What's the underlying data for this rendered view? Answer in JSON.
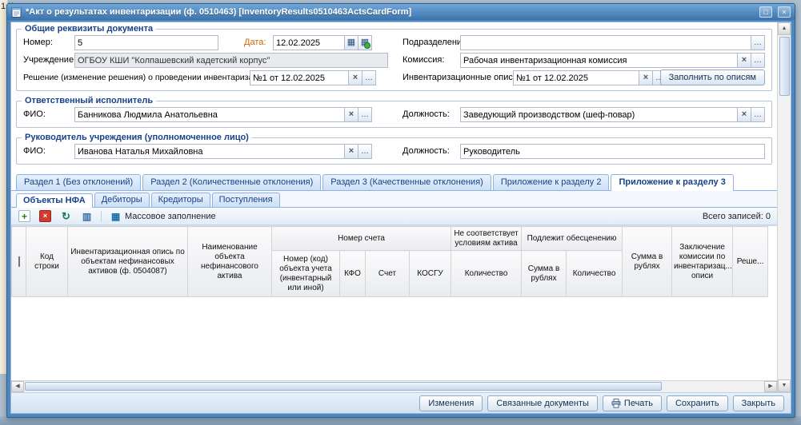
{
  "colors": {
    "accent": "#15428b",
    "titlebar_top": "#71a7d8",
    "titlebar_bottom": "#3c73aa",
    "date_label": "#cc6608",
    "delete_icon": "#d23b2f",
    "add_icon": "#1e7d1e"
  },
  "icons": {
    "add": "+",
    "delete": "×",
    "refresh": "↻",
    "copy": "▥",
    "mass_fill": "▦",
    "lookup": "…",
    "clear": "×",
    "calendar": "▦",
    "calendar_today": "▦",
    "maximize": "□",
    "close": "×",
    "arrow_up": "▲",
    "arrow_down": "▼",
    "arrow_left": "◀",
    "arrow_right": "▶"
  },
  "background": {
    "partial_text": "1 К"
  },
  "window": {
    "title": "*Акт о результатах инвентаризации (ф. 0510463) [InventoryResults0510463ActsCardForm]"
  },
  "general": {
    "legend": "Общие реквизиты документа",
    "number_label": "Номер:",
    "number_value": "5",
    "date_label": "Дата:",
    "date_value": "12.02.2025",
    "department_label": "Подразделение:",
    "department_value": "",
    "institution_label": "Учреждение:",
    "institution_value": "ОГБОУ КШИ \"Колпашевский кадетский корпус\"",
    "commission_label": "Комиссия:",
    "commission_value": "Рабочая инвентаризационная комиссия",
    "decision_label": "Решение (изменение решения) о проведении инвентаризации:",
    "decision_value": "№1 от 12.02.2025",
    "inventories_label": "Инвентаризационные описи:",
    "inventories_value": "№1 от 12.02.2025",
    "fill_by_inventories_button": "Заполнить по описям"
  },
  "responsible": {
    "legend": "Ответственный исполнитель",
    "fio_label": "ФИО:",
    "fio_value": "Банникова Людмила Анатольевна",
    "position_label": "Должность:",
    "position_value": "Заведующий производством (шеф-повар)"
  },
  "head": {
    "legend": "Руководитель учреждения (уполномоченное лицо)",
    "fio_label": "ФИО:",
    "fio_value": "Иванова Наталья Михайловна",
    "position_label": "Должность:",
    "position_value": "Руководитель"
  },
  "main_tabs": {
    "items": [
      {
        "label": "Раздел 1 (Без отклонений)"
      },
      {
        "label": "Раздел 2 (Количественные отклонения)"
      },
      {
        "label": "Раздел 3 (Качественные отклонения)"
      },
      {
        "label": "Приложение к разделу 2"
      },
      {
        "label": "Приложение к разделу 3"
      }
    ],
    "active_index": 4
  },
  "sub_tabs": {
    "items": [
      {
        "label": "Объекты НФА"
      },
      {
        "label": "Дебиторы"
      },
      {
        "label": "Кредиторы"
      },
      {
        "label": "Поступления"
      }
    ],
    "active_index": 0
  },
  "toolbar": {
    "mass_fill_label": "Массовое заполнение",
    "total_records": "Всего записей: 0"
  },
  "grid": {
    "groups": {
      "account_number": "Номер счета",
      "not_matching_asset": "Не соответствует условиям актива",
      "impairment": "Подлежит обесценению"
    },
    "columns": {
      "row_code": "Код строки",
      "inventory_list": "Инвентаризационная опись по объектам нефинансовых активов (ф. 0504087)",
      "object_name": "Наименование объекта нефинансового актива",
      "object_number": "Номер (код) объекта учета (инвентарный или иной)",
      "kfo": "КФО",
      "account": "Счет",
      "kosgu": "КОСГУ",
      "qty_not_matching": "Количество",
      "sum_rub_1": "Сумма в рублях",
      "qty_impairment": "Количество",
      "sum_rub_2": "Сумма в рублях",
      "commission_conclusion": "Заключение комиссии по инвентаризац... описи",
      "decision_cut": "Реше..."
    }
  },
  "footer": {
    "buttons": [
      "Изменения",
      "Связанные документы",
      "Печать",
      "Сохранить",
      "Закрыть"
    ]
  }
}
